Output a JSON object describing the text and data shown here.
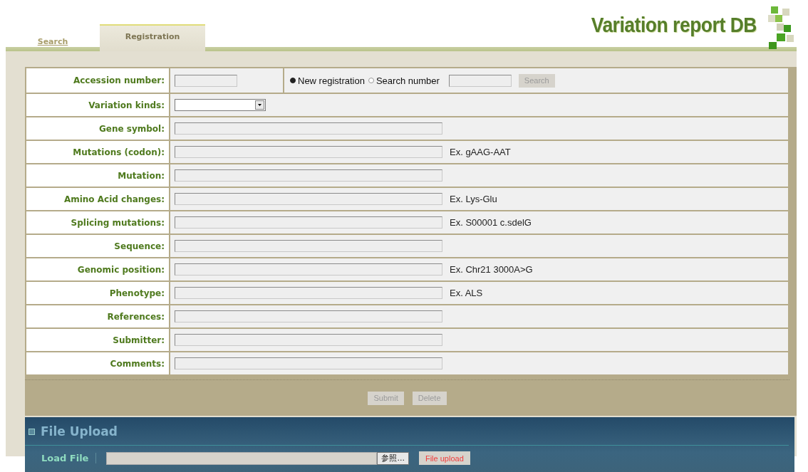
{
  "header": {
    "title": "Variation report DB"
  },
  "tabs": [
    {
      "label": "Search",
      "selected": false
    },
    {
      "label": "Registration",
      "selected": true
    }
  ],
  "form": {
    "rows": [
      {
        "kind": "accession",
        "label": "Accession number:",
        "radios": [
          {
            "label": "New registration",
            "selected": true
          },
          {
            "label": "Search number",
            "selected": false
          }
        ],
        "button": "Search"
      },
      {
        "kind": "select",
        "label": "Variation kinds:"
      },
      {
        "kind": "text",
        "label": "Gene symbol:"
      },
      {
        "kind": "text",
        "label": "Mutations (codon):",
        "example": "Ex. gAAG-AAT"
      },
      {
        "kind": "text",
        "label": "Mutation:"
      },
      {
        "kind": "text",
        "label": "Amino Acid changes:",
        "example": "Ex. Lys-Glu"
      },
      {
        "kind": "text",
        "label": "Splicing mutations:",
        "example": "Ex. S00001 c.sdelG"
      },
      {
        "kind": "text",
        "label": "Sequence:"
      },
      {
        "kind": "text",
        "label": "Genomic position:",
        "example": "Ex. Chr21 3000A>G"
      },
      {
        "kind": "text",
        "label": "Phenotype:",
        "example": "Ex. ALS"
      },
      {
        "kind": "text",
        "label": "References:"
      },
      {
        "kind": "text",
        "label": "Submitter:"
      },
      {
        "kind": "text",
        "label": "Comments:"
      }
    ],
    "buttons": [
      "Submit",
      "Delete"
    ]
  },
  "file_upload": {
    "title": "File Upload",
    "label": "Load File",
    "browse": "参照...",
    "button": "File upload"
  }
}
